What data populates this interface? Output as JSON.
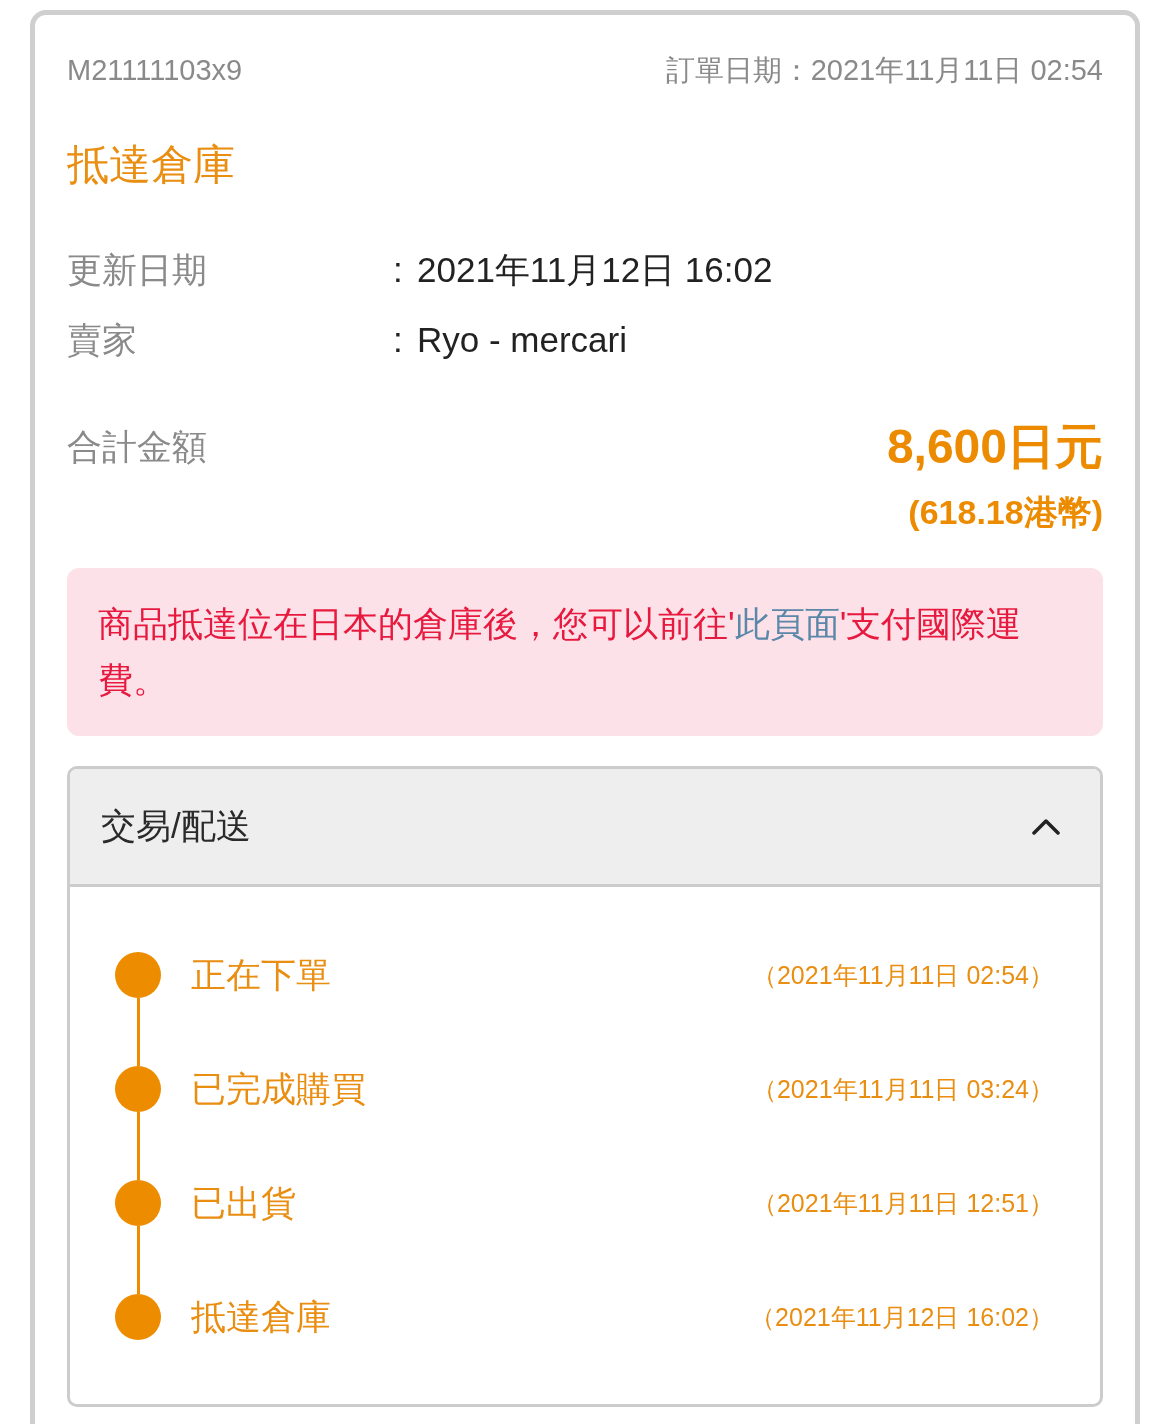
{
  "order": {
    "number": "M21111103x9",
    "date": "訂單日期：2021年11月11日 02:54",
    "status": "抵達倉庫"
  },
  "details": [
    {
      "label": "更新日期",
      "separator": ":",
      "value": "2021年11月12日 16:02"
    },
    {
      "label": "賣家",
      "separator": ":",
      "value": "Ryo - mercari"
    }
  ],
  "total": {
    "label": "合計金額",
    "amount": "8,600日元",
    "converted": "(618.18港幣)"
  },
  "notice": {
    "before": "商品抵達位在日本的倉庫後，您可以前往'",
    "link": "此頁面",
    "after": "'支付國際運費。"
  },
  "section": {
    "title": "交易/配送",
    "expanded": true,
    "steps": [
      {
        "label": "正在下單",
        "time": "（2021年11月11日 02:54）"
      },
      {
        "label": "已完成購買",
        "time": "（2021年11月11日 03:24）"
      },
      {
        "label": "已出貨",
        "time": "（2021年11月11日 12:51）"
      },
      {
        "label": "抵達倉庫",
        "time": "（2021年11月12日 16:02）"
      }
    ]
  }
}
